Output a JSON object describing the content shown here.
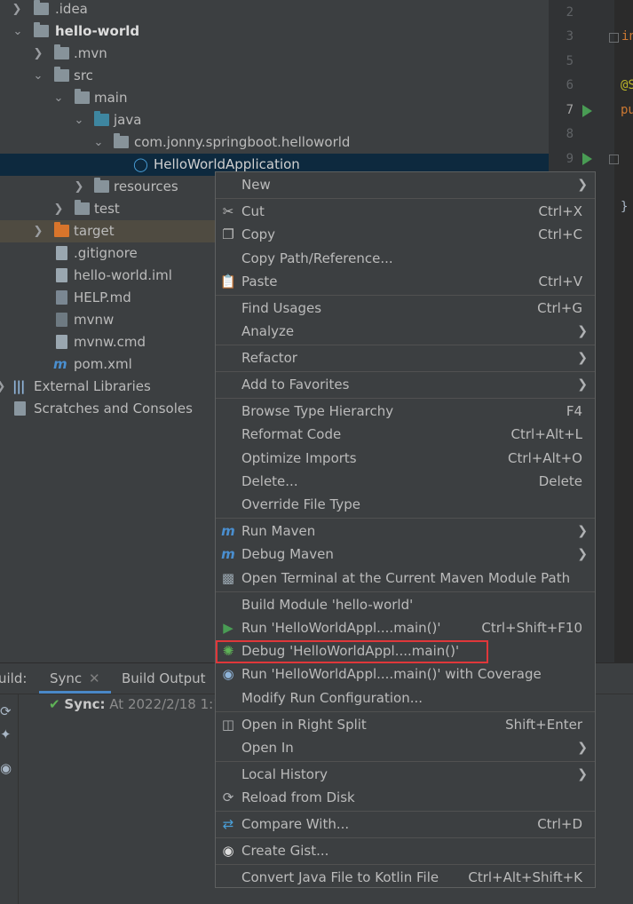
{
  "project_tree": {
    "items": [
      {
        "label": ".idea",
        "icon": "folder-icon"
      },
      {
        "label": "hello-world",
        "icon": "module-folder-icon"
      },
      {
        "label": ".mvn",
        "icon": "folder-icon"
      },
      {
        "label": "src",
        "icon": "folder-icon"
      },
      {
        "label": "main",
        "icon": "folder-icon"
      },
      {
        "label": "java",
        "icon": "source-folder-icon"
      },
      {
        "label": "com.jonny.springboot.helloworld",
        "icon": "package-icon"
      },
      {
        "label": "HelloWorldApplication",
        "icon": "spring-class-icon"
      },
      {
        "label": "resources",
        "icon": "resources-folder-icon"
      },
      {
        "label": "test",
        "icon": "folder-icon"
      },
      {
        "label": "target",
        "icon": "excluded-folder-icon"
      },
      {
        "label": ".gitignore",
        "icon": "gitignore-file-icon"
      },
      {
        "label": "hello-world.iml",
        "icon": "iml-file-icon"
      },
      {
        "label": "HELP.md",
        "icon": "markdown-file-icon"
      },
      {
        "label": "mvnw",
        "icon": "shell-file-icon"
      },
      {
        "label": "mvnw.cmd",
        "icon": "text-file-icon"
      },
      {
        "label": "pom.xml",
        "icon": "maven-icon"
      },
      {
        "label": "External Libraries",
        "icon": "libraries-icon"
      },
      {
        "label": "Scratches and Consoles",
        "icon": "scratches-icon"
      }
    ]
  },
  "editor": {
    "line_numbers": [
      "2",
      "3",
      "5",
      "6",
      "7",
      "8",
      "9"
    ],
    "code_fragments": [
      "in",
      "@S",
      "pu",
      "}"
    ]
  },
  "build_panel": {
    "title": "uild:",
    "tabs": [
      "Sync",
      "Build Output"
    ],
    "sync_label": "Sync:",
    "sync_status": "At 2022/2/18 1:1"
  },
  "context_menu": {
    "items": [
      {
        "label": "New",
        "shortcut": "",
        "submenu": true,
        "icon": ""
      },
      {
        "label": "Cut",
        "shortcut": "Ctrl+X",
        "icon": "scissors-icon"
      },
      {
        "label": "Copy",
        "shortcut": "Ctrl+C",
        "icon": "copy-icon"
      },
      {
        "label": "Copy Path/Reference...",
        "shortcut": ""
      },
      {
        "label": "Paste",
        "shortcut": "Ctrl+V",
        "icon": "clipboard-icon"
      },
      {
        "label": "Find Usages",
        "shortcut": "Ctrl+G"
      },
      {
        "label": "Analyze",
        "shortcut": "",
        "submenu": true
      },
      {
        "label": "Refactor",
        "shortcut": "",
        "submenu": true
      },
      {
        "label": "Add to Favorites",
        "shortcut": "",
        "submenu": true
      },
      {
        "label": "Browse Type Hierarchy",
        "shortcut": "F4"
      },
      {
        "label": "Reformat Code",
        "shortcut": "Ctrl+Alt+L"
      },
      {
        "label": "Optimize Imports",
        "shortcut": "Ctrl+Alt+O"
      },
      {
        "label": "Delete...",
        "shortcut": "Delete"
      },
      {
        "label": "Override File Type",
        "shortcut": ""
      },
      {
        "label": "Run Maven",
        "shortcut": "",
        "submenu": true,
        "icon": "maven-run-icon"
      },
      {
        "label": "Debug Maven",
        "shortcut": "",
        "submenu": true,
        "icon": "maven-debug-icon"
      },
      {
        "label": "Open Terminal at the Current Maven Module Path",
        "shortcut": "",
        "icon": "terminal-icon"
      },
      {
        "label": "Build Module 'hello-world'",
        "shortcut": ""
      },
      {
        "label": "Run 'HelloWorldAppl....main()'",
        "shortcut": "Ctrl+Shift+F10",
        "icon": "run-icon"
      },
      {
        "label": "Debug 'HelloWorldAppl....main()'",
        "shortcut": "",
        "icon": "bug-icon"
      },
      {
        "label": "Run 'HelloWorldAppl....main()' with Coverage",
        "shortcut": "",
        "icon": "coverage-icon"
      },
      {
        "label": "Modify Run Configuration...",
        "shortcut": ""
      },
      {
        "label": "Open in Right Split",
        "shortcut": "Shift+Enter",
        "icon": "split-icon"
      },
      {
        "label": "Open In",
        "shortcut": "",
        "submenu": true
      },
      {
        "label": "Local History",
        "shortcut": "",
        "submenu": true
      },
      {
        "label": "Reload from Disk",
        "shortcut": "",
        "icon": "reload-icon"
      },
      {
        "label": "Compare With...",
        "shortcut": "Ctrl+D",
        "icon": "compare-icon"
      },
      {
        "label": "Create Gist...",
        "shortcut": "",
        "icon": "github-icon"
      },
      {
        "label": "Convert Java File to Kotlin File",
        "shortcut": "Ctrl+Alt+Shift+K"
      }
    ]
  },
  "colors": {
    "highlight_border": "#e0373a",
    "run_green": "#499c54",
    "selection": "#0d293e"
  }
}
